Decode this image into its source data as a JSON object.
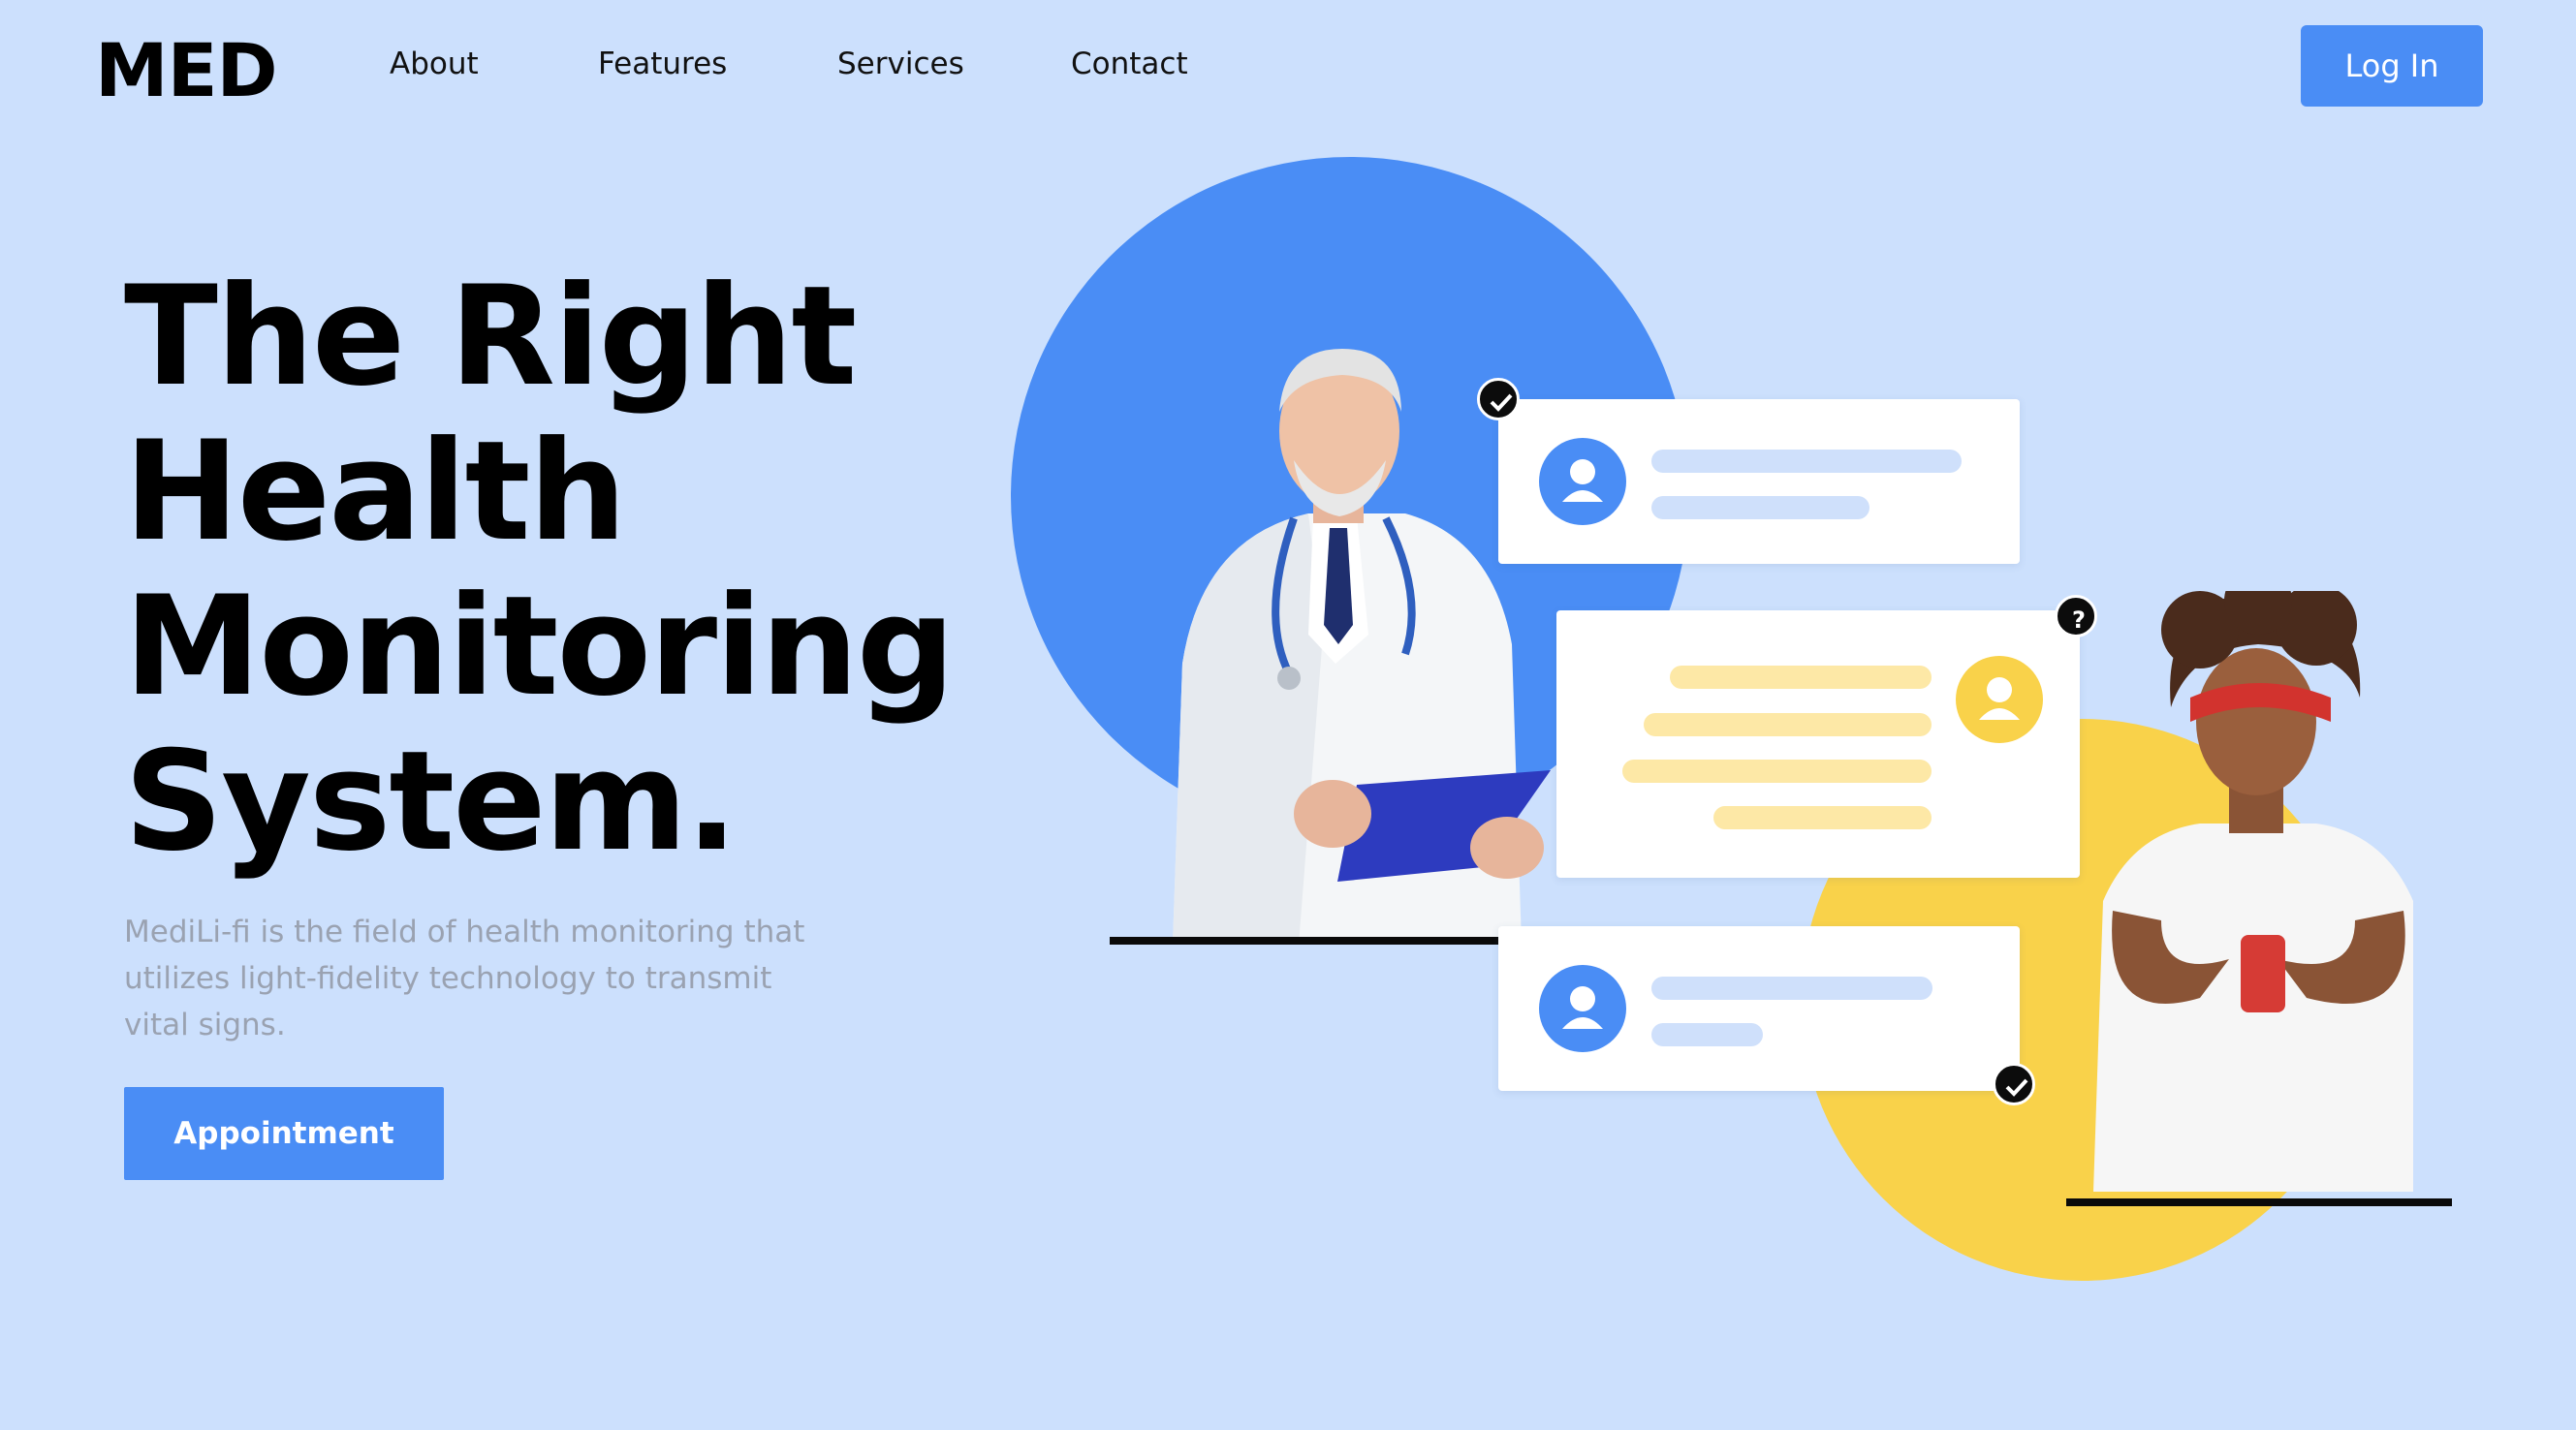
{
  "header": {
    "logo": "MED",
    "nav": [
      "About",
      "Features",
      "Services",
      "Contact"
    ],
    "login_label": "Log In"
  },
  "hero": {
    "title_lines": [
      "The Right",
      "Health",
      "Monitoring",
      "System."
    ],
    "description": "MediLi-fi is the field of health monitoring that utilizes light-fidelity technology to transmit vital signs.",
    "appointment_label": "Appointment"
  },
  "illustration": {
    "doctor": "doctor-photo",
    "patient": "woman-with-phone-photo",
    "badges": [
      "check-icon",
      "question-icon",
      "check-icon"
    ]
  },
  "colors": {
    "background": "#cce0fd",
    "accent_blue": "#4a8df5",
    "accent_yellow": "#f9d24a",
    "light_blue_bar": "#cfe0fb",
    "light_yellow_bar": "#fde8a6"
  }
}
